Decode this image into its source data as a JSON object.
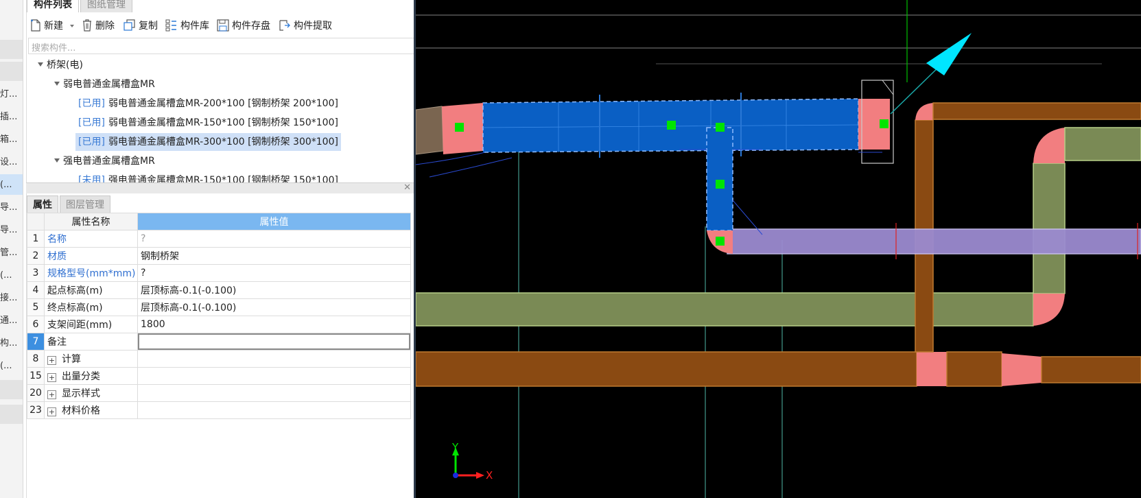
{
  "left_strip": {
    "items": [
      "灯...",
      "插...",
      "箱...",
      "设...",
      "(...",
      "导...",
      "导...",
      "管...",
      "(...",
      "接...",
      "通...",
      "构...",
      "(..."
    ]
  },
  "component_panel": {
    "tabs": [
      "构件列表",
      "图纸管理"
    ],
    "toolbar": {
      "new": "新建",
      "delete": "删除",
      "copy": "复制",
      "library": "构件库",
      "save": "构件存盘",
      "extract": "构件提取"
    },
    "search_placeholder": "搜索构件...",
    "tree": {
      "root": "桥架(电)",
      "group1": "弱电普通金属槽盒MR",
      "items1": [
        {
          "tag": "[已用]",
          "name": "弱电普通金属槽盒MR-200*100 [钢制桥架 200*100]"
        },
        {
          "tag": "[已用]",
          "name": "弱电普通金属槽盒MR-150*100 [钢制桥架 150*100]"
        },
        {
          "tag": "[已用]",
          "name": "弱电普通金属槽盒MR-300*100 [钢制桥架 300*100]"
        }
      ],
      "group2": "强电普通金属槽盒MR",
      "items2": [
        {
          "tag": "[未用]",
          "name": "强电普通金属槽盒MR-150*100 [钢制桥架 150*100]"
        }
      ]
    }
  },
  "property_panel": {
    "tabs": [
      "属性",
      "图层管理"
    ],
    "headers": [
      "属性名称",
      "属性值"
    ],
    "rows": [
      {
        "num": "1",
        "name": "名称",
        "value": "?"
      },
      {
        "num": "2",
        "name": "材质",
        "value": "钢制桥架"
      },
      {
        "num": "3",
        "name": "规格型号(mm*mm)",
        "value": "?"
      },
      {
        "num": "4",
        "name": "起点标高(m)",
        "value": "层顶标高-0.1(-0.100)"
      },
      {
        "num": "5",
        "name": "终点标高(m)",
        "value": "层顶标高-0.1(-0.100)"
      },
      {
        "num": "6",
        "name": "支架间距(mm)",
        "value": "1800"
      },
      {
        "num": "7",
        "name": "备注",
        "value": ""
      },
      {
        "num": "8",
        "name": "计算",
        "value": ""
      },
      {
        "num": "15",
        "name": "出量分类",
        "value": ""
      },
      {
        "num": "20",
        "name": "显示样式",
        "value": ""
      },
      {
        "num": "23",
        "name": "材料价格",
        "value": ""
      }
    ]
  },
  "viewport": {
    "axis_x": "X",
    "axis_y": "Y",
    "colors": {
      "background": "#000000",
      "selected_tray": "#0a5fc4",
      "brown_tray": "#8a4a12",
      "olive_tray": "#7a8a55",
      "purple_tray": "#9b8bd0",
      "fitting": "#f27e80",
      "grip": "#00e400",
      "arrow": "#00e5ff"
    }
  }
}
